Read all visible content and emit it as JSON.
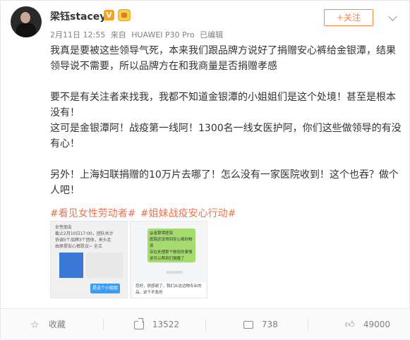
{
  "header": {
    "username": "梁钰stacey",
    "verified_badge": "V",
    "date": "2月11日 12:55",
    "source_prefix": "来自",
    "device": "HUAWEI P30 Pro",
    "edited": "已编辑",
    "follow_label": "+关注"
  },
  "post": {
    "paragraphs": [
      "我真是要被这些领导气死，本来我们跟品牌方说好了捐赠安心裤给金银潭，结果领导说不需要，所以品牌方在和我商量是否捐赠孝感",
      "要不是有关注者来找我，我都不知道金银潭的小姐姐们是这个处境！甚至是根本没有！",
      "这可是金银潭阿！战疫第一线阿！1300名一线女医护阿，你们这些做领导的有没有心！",
      "另外！上海妇联捐赠的10万片去哪了！怎么没有一家医院收到！这个也吞？做个人吧！"
    ],
    "tags": [
      "#看见女性劳动者#",
      "#姐妹战疫安心行动#"
    ]
  },
  "thumbnails": {
    "thumb1_lines": [
      "女性朋友",
      "截止2月10日17:00，团队共计",
      "协调5个品牌3个团体，来头走",
      "由原提安心裤跌议~ 全文"
    ],
    "thumb1_bubble": "是这个小姐姐",
    "thumb2_lines": [
      "@金银潭医院",
      "医院还没得到安心裤的物资",
      "存在处理那个物流的事情",
      "说可以帮到们捐赠了"
    ],
    "thumb2_bottom": "您好，很感谢了，我们从这边物专业的",
    "thumb2_bottom2": "品，这个不急的"
  },
  "actions": {
    "favorite_label": "收藏",
    "repost_count": "13522",
    "comment_count": "738",
    "like_count": "49000"
  },
  "colors": {
    "accent_orange": "#ff8140",
    "tag_color": "#eb7350",
    "meta_gray": "#808080"
  },
  "icons": {
    "verified": "verified-v-icon",
    "vip": "vip-crown-icon",
    "chevron": "chevron-down-icon",
    "favorite": "star-icon",
    "repost": "repost-icon",
    "comment": "comment-icon",
    "like": "thumbs-up-icon"
  }
}
